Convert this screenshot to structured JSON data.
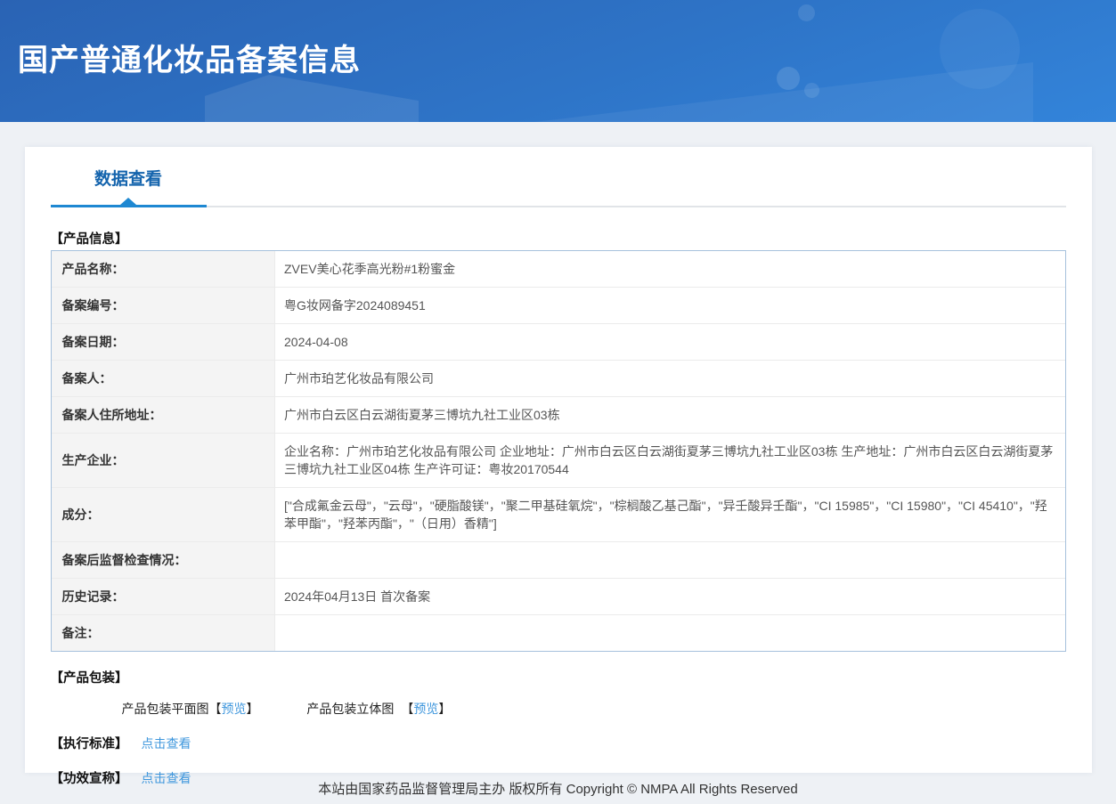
{
  "header": {
    "title": "国产普通化妆品备案信息"
  },
  "tabs": {
    "data_view_label": "数据查看"
  },
  "product_info": {
    "section_title": "【产品信息】",
    "rows": [
      {
        "label": "产品名称：",
        "value": "ZVEV美心花季高光粉#1粉蜜金"
      },
      {
        "label": "备案编号：",
        "value": "粤G妆网备字2024089451"
      },
      {
        "label": "备案日期：",
        "value": "2024-04-08"
      },
      {
        "label": "备案人：",
        "value": "广州市珀艺化妆品有限公司"
      },
      {
        "label": "备案人住所地址：",
        "value": "广州市白云区白云湖街夏茅三博坑九社工业区03栋"
      },
      {
        "label": "生产企业：",
        "value": "企业名称：广州市珀艺化妆品有限公司 企业地址：广州市白云区白云湖街夏茅三博坑九社工业区03栋 生产地址：广州市白云区白云湖街夏茅三博坑九社工业区04栋 生产许可证：粤妆20170544"
      },
      {
        "label": "成分：",
        "value": "[\"合成氟金云母\"，\"云母\"，\"硬脂酸镁\"，\"聚二甲基硅氧烷\"，\"棕榈酸乙基己酯\"，\"异壬酸异壬酯\"，\"CI 15985\"，\"CI 15980\"，\"CI 45410\"，\"羟苯甲酯\"，\"羟苯丙酯\"，\"（日用）香精\"]"
      },
      {
        "label": "备案后监督检查情况：",
        "value": ""
      },
      {
        "label": "历史记录：",
        "value": "2024年04月13日 首次备案"
      },
      {
        "label": "备注：",
        "value": ""
      }
    ]
  },
  "packaging": {
    "section_title": "【产品包装】",
    "flat_label": "产品包装平面图",
    "stereo_label": "产品包装立体图",
    "bracket_open": "【",
    "preview_link": "预览",
    "bracket_close": "】"
  },
  "standards": {
    "section_title": "【执行标准】",
    "link_label": "点击查看"
  },
  "efficacy": {
    "section_title": "【功效宣称】",
    "link_label": "点击查看"
  },
  "footer": {
    "text": "本站由国家药品监督管理局主办 版权所有 Copyright © NMPA All Rights Reserved"
  },
  "colors": {
    "header_gradient_start": "#2a63b4",
    "header_gradient_end": "#3384da",
    "tab_text": "#1464ad",
    "tab_underline": "#1e88d2",
    "table_outer_border": "#a6c1dc",
    "table_inner_border": "#ebebeb",
    "label_cell_bg": "#f4f4f4",
    "link": "#3f97dd",
    "page_bg": "#eef1f5"
  }
}
